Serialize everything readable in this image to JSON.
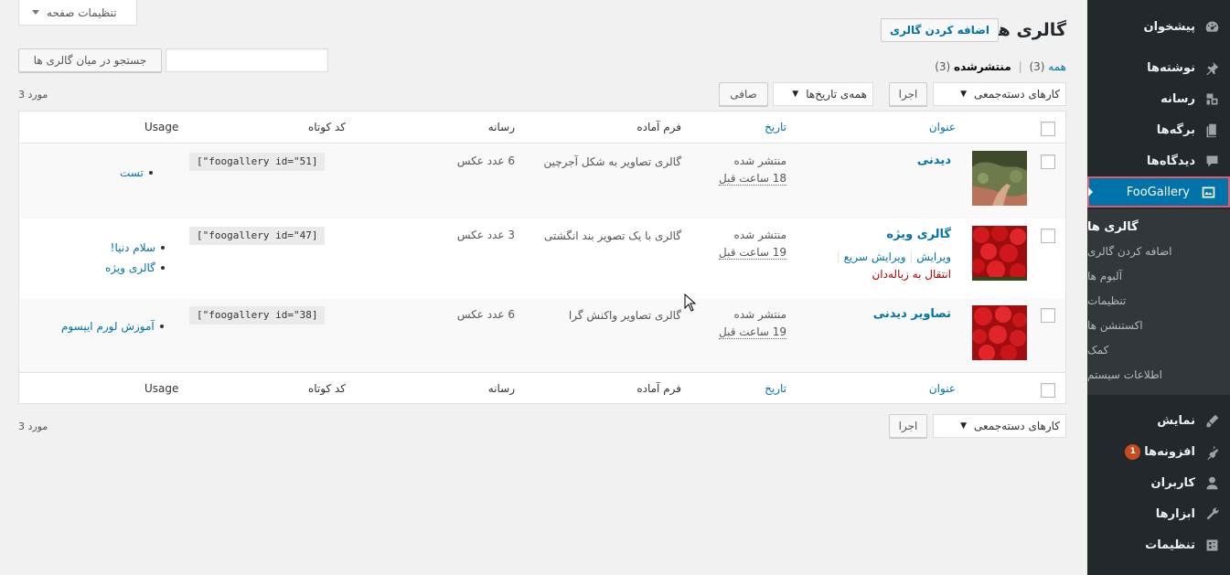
{
  "sidebar": {
    "items_top": [
      {
        "label": "پیشخوان",
        "icon": "dashboard-icon"
      },
      {
        "label": "نوشته‌ها",
        "icon": "pin-icon"
      },
      {
        "label": "رسانه",
        "icon": "media-icon"
      },
      {
        "label": "برگه‌ها",
        "icon": "pages-icon"
      },
      {
        "label": "دیدگاه‌ها",
        "icon": "comments-icon"
      }
    ],
    "active": {
      "label": "FooGallery",
      "icon": "gallery-icon"
    },
    "submenu": [
      "گالری ها",
      "اضافه کردن گالری",
      "آلبوم ها",
      "تنظیمات",
      "اکستنشن ها",
      "کمک",
      "اطلاعات سیستم"
    ],
    "items_bottom": [
      {
        "label": "نمایش",
        "icon": "appearance-icon"
      },
      {
        "label": "افزونه‌ها",
        "icon": "plugins-icon",
        "badge": "1"
      },
      {
        "label": "کاربران",
        "icon": "users-icon"
      },
      {
        "label": "ابزارها",
        "icon": "tools-icon"
      },
      {
        "label": "تنظیمات",
        "icon": "settings-icon"
      }
    ]
  },
  "header": {
    "screen_options": "تنظیمات صفحه",
    "title": "گالری ها",
    "add_button": "اضافه کردن گالری"
  },
  "filters": {
    "all": "همه",
    "all_count": "(3)",
    "published": "منتشرشده",
    "published_count": "(3)",
    "search_button": "جستجو در میان گالری ها",
    "search_value": "",
    "bulk_actions": "کارهای دسته‌جمعی",
    "apply": "اجرا",
    "all_dates": "همه‌ی تاریخ‌ها",
    "filter": "صافی",
    "items_count": "3 مورد"
  },
  "table": {
    "headers": {
      "title": "عنوان",
      "date": "تاریخ",
      "template": "فرم آماده",
      "media": "رسانه",
      "shortcode": "کد کوتاه",
      "usage": "Usage"
    },
    "rows": [
      {
        "title": "دیدنی",
        "status": "منتشر شده",
        "ago": "18 ساعت قبل",
        "template": "گالری تصاویر به شکل آجرچین",
        "media": "6 عدد عکس",
        "shortcode": "[\"foogallery id=\"51]",
        "usage": [
          "تست"
        ]
      },
      {
        "title": "گالری ویژه",
        "status": "منتشر شده",
        "ago": "19 ساعت قبل",
        "template": "گالری با یک تصویر بند انگشتی",
        "media": "3 عدد عکس",
        "shortcode": "[\"foogallery id=\"47]",
        "usage": [
          "سلام دنیا!",
          "گالری ویژه"
        ],
        "actions": {
          "edit": "ویرایش",
          "quick_edit": "ویرایش سریع",
          "trash": "انتقال به زباله‌دان"
        }
      },
      {
        "title": "تصاویر دیدنی",
        "status": "منتشر شده",
        "ago": "19 ساعت قبل",
        "template": "گالری تصاویر واکنش گرا",
        "media": "6 عدد عکس",
        "shortcode": "[\"foogallery id=\"38]",
        "usage": [
          "آموزش لورم ایپسوم"
        ]
      }
    ]
  },
  "colors": {
    "sidebar_bg": "#23282d",
    "accent": "#0073aa",
    "highlight_border": "#e05a67"
  }
}
